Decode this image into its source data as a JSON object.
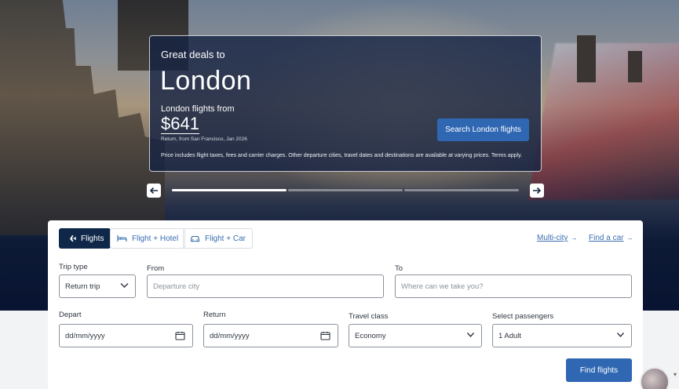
{
  "promo": {
    "eyebrow": "Great deals to",
    "city": "London",
    "from_label": "London flights from",
    "price": "$641",
    "return_note": "Return, from San Francisco, Jan 2026",
    "cta": "Search London flights",
    "disclaimer": "Price includes flight taxes, fees and carrier charges. Other departure cities, travel dates and destinations are available at varying prices. Terms apply."
  },
  "carousel": {
    "prev_icon": "arrow-left-icon",
    "next_icon": "arrow-right-icon",
    "progress": [
      1,
      0,
      0
    ]
  },
  "tabs": [
    {
      "label": "Flights",
      "icon": "plane-icon",
      "active": true
    },
    {
      "label": "Flight + Hotel",
      "icon": "bed-icon",
      "active": false
    },
    {
      "label": "Flight + Car",
      "icon": "car-icon",
      "active": false
    }
  ],
  "links": {
    "multi_city": "Multi-city",
    "find_car": "Find a car",
    "arrow": "→"
  },
  "form": {
    "trip_type_label": "Trip type",
    "trip_type_value": "Return trip",
    "from_label": "From",
    "from_placeholder": "Departure city",
    "to_label": "To",
    "to_placeholder": "Where can we take you?",
    "depart_label": "Depart",
    "depart_placeholder": "dd/mm/yyyy",
    "return_label": "Return",
    "return_placeholder": "dd/mm/yyyy",
    "class_label": "Travel class",
    "class_value": "Economy",
    "passengers_label": "Select passengers",
    "passengers_value": "1 Adult",
    "submit": "Find flights"
  },
  "colors": {
    "primary": "#2f67b3",
    "navy": "#0f2849",
    "link": "#3a6db0"
  }
}
